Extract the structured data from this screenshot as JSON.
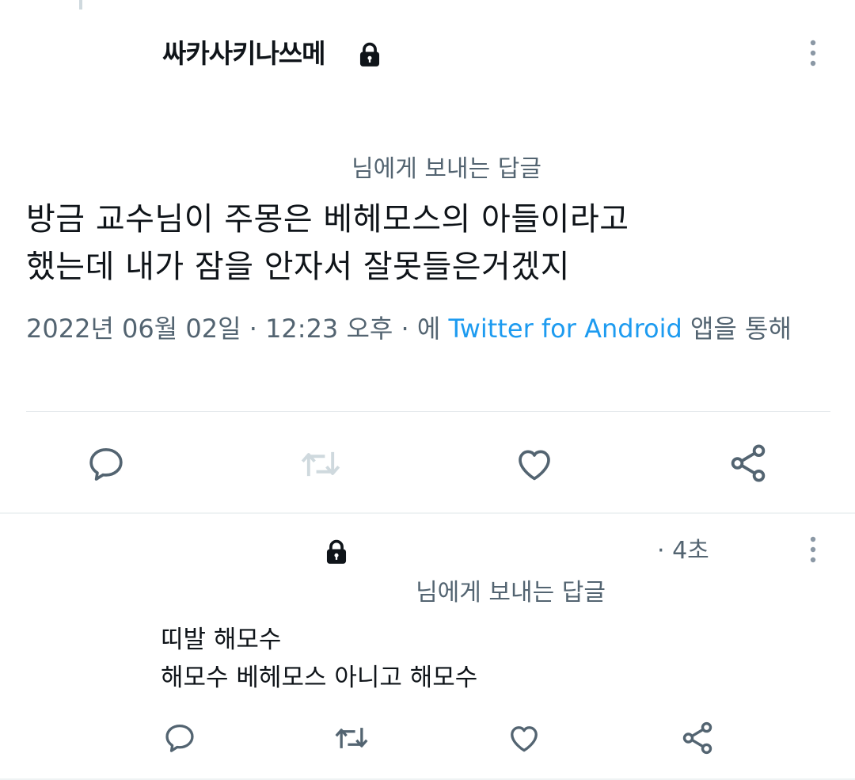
{
  "main_tweet": {
    "author_name": "싸카사키나쓰메",
    "replying_to": "님에게 보내는 답글",
    "text_line1": "방금 교수님이 주몽은 베헤모스의 아들이라고",
    "text_line2": "했는데 내가 잠을 안자서 잘못들은거겠지",
    "date": "2022년 06월 02일",
    "separator": "·",
    "time": "12:23 오후",
    "via_prefix": "에",
    "client": "Twitter for Android",
    "via_suffix": "앱을 통해"
  },
  "reply_tweet": {
    "time": "· 4초",
    "replying_to": "님에게 보내는 답글",
    "text_line1": "띠발 해모수",
    "text_line2": "해모수 베헤모스 아니고 해모수"
  },
  "icons": {
    "lock": "lock-icon",
    "more": "more-vertical-icon",
    "reply": "reply-icon",
    "retweet": "retweet-icon",
    "like": "like-icon",
    "share": "share-icon"
  },
  "colors": {
    "link": "#1d9bf0",
    "secondary_text": "#536471",
    "action_icon": "#536471",
    "retweet_disabled": "#cfd9de"
  }
}
